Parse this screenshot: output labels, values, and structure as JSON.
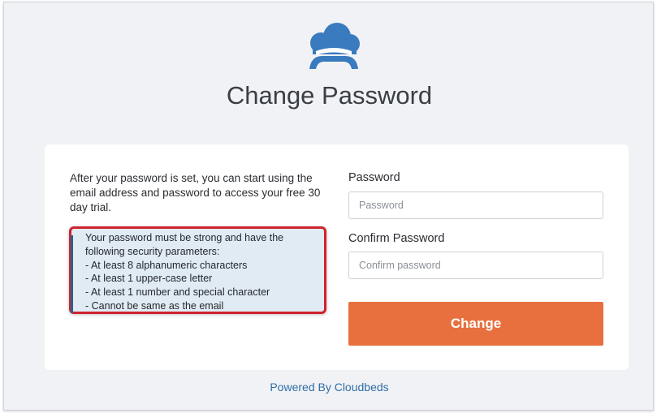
{
  "header": {
    "title": "Change Password",
    "logo_icon": "cloud-bed-logo-icon"
  },
  "intro_text": "After your password is set, you can start using the email address and password to access your free 30 day trial.",
  "requirements": {
    "lines": [
      "Your password must be strong and have the",
      "following security parameters:",
      "- At least 8 alphanumeric characters",
      "- At least 1 upper-case letter",
      "- At least 1 number and special character",
      "- Cannot be same as the email"
    ]
  },
  "form": {
    "password_label": "Password",
    "password_placeholder": "Password",
    "confirm_label": "Confirm Password",
    "confirm_placeholder": "Confirm password",
    "submit_label": "Change"
  },
  "footer": {
    "powered_by": "Powered By Cloudbeds"
  },
  "colors": {
    "brand_blue": "#3a7bbf",
    "button_orange": "#e8703f",
    "highlight_red": "#d0232d"
  }
}
